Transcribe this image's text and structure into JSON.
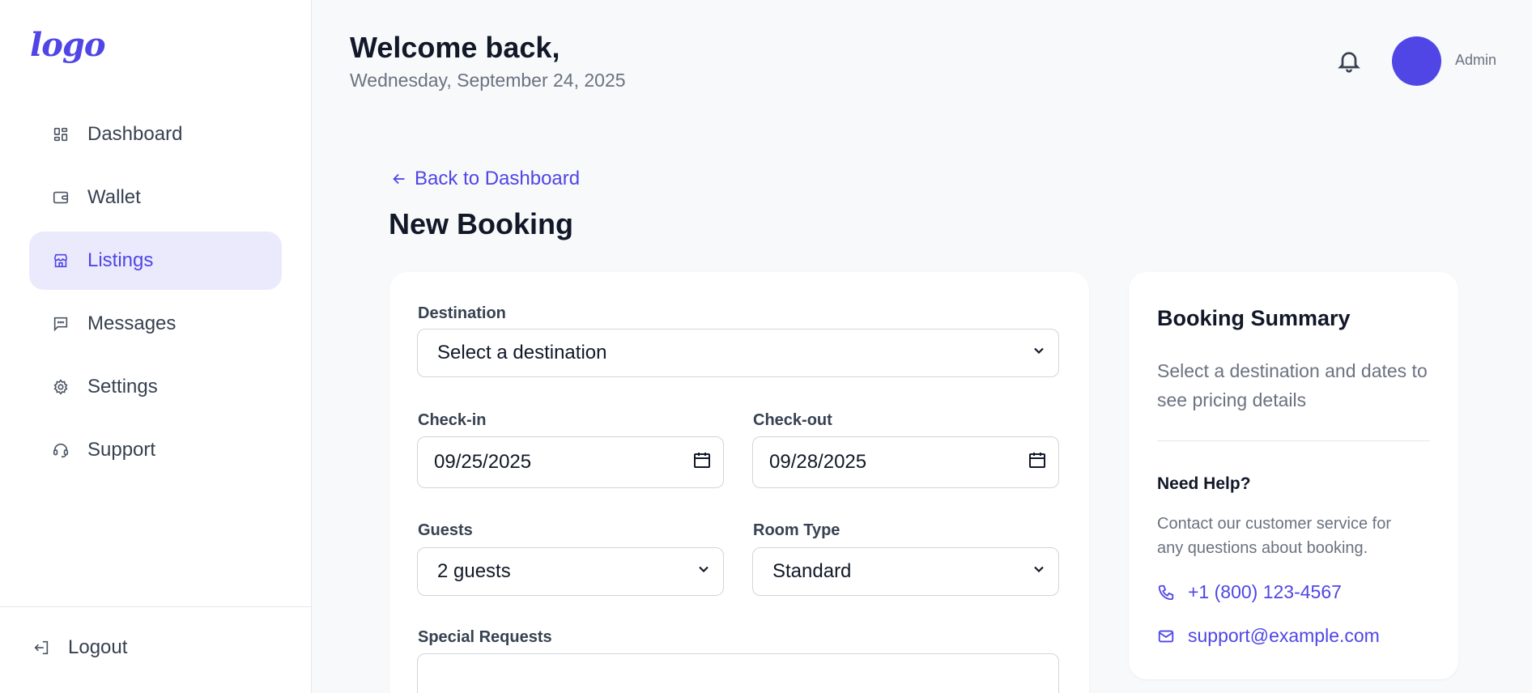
{
  "sidebar": {
    "logo": "logo",
    "items": [
      {
        "label": "Dashboard",
        "icon": "dashboard-icon"
      },
      {
        "label": "Wallet",
        "icon": "wallet-icon"
      },
      {
        "label": "Listings",
        "icon": "store-icon",
        "active": true
      },
      {
        "label": "Messages",
        "icon": "message-icon"
      },
      {
        "label": "Settings",
        "icon": "gear-icon"
      },
      {
        "label": "Support",
        "icon": "headset-icon"
      }
    ],
    "logout_label": "Logout"
  },
  "header": {
    "welcome": "Welcome back,",
    "date": "Wednesday, September 24, 2025",
    "user_label": "Admin"
  },
  "main": {
    "back_label": "Back to Dashboard",
    "title": "New Booking",
    "form": {
      "destination": {
        "label": "Destination",
        "value": "Select a destination"
      },
      "check_in": {
        "label": "Check-in",
        "value": "09/25/2025"
      },
      "check_out": {
        "label": "Check-out",
        "value": "09/28/2025"
      },
      "guests": {
        "label": "Guests",
        "value": "2 guests"
      },
      "room_type": {
        "label": "Room Type",
        "value": "Standard"
      },
      "special_requests": {
        "label": "Special Requests"
      }
    },
    "summary": {
      "title": "Booking Summary",
      "text": "Select a destination and dates to see pricing details",
      "help_title": "Need Help?",
      "help_text": "Contact our customer service for any questions about booking.",
      "phone": "+1 (800) 123-4567",
      "email": "support@example.com"
    }
  },
  "colors": {
    "accent": "#4f46e5",
    "active_bg": "#ebeafd",
    "page_bg": "#f8f9fb"
  }
}
